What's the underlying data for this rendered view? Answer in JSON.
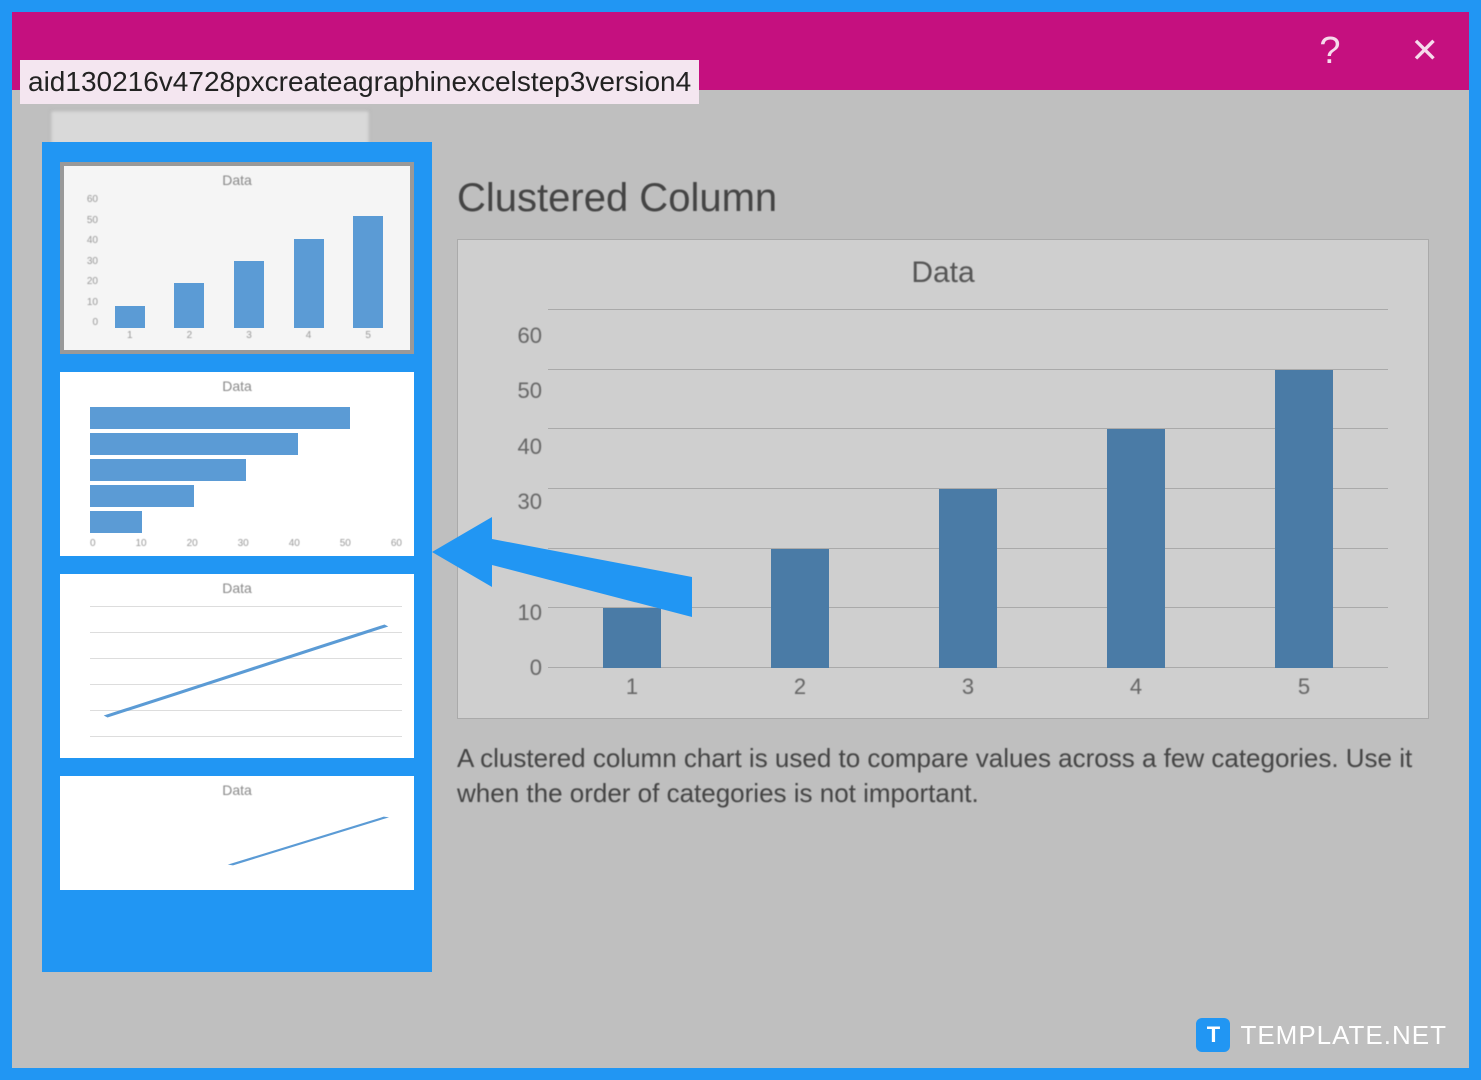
{
  "overlay_label": "aid130216v4728pxcreateagraphinexcelstep3version4",
  "titlebar": {
    "help": "?",
    "close": "✕"
  },
  "sidebar": {
    "thumbs": [
      {
        "title": "Data",
        "type": "column"
      },
      {
        "title": "Data",
        "type": "bar"
      },
      {
        "title": "Data",
        "type": "line"
      },
      {
        "title": "Data",
        "type": "line2"
      }
    ]
  },
  "preview": {
    "heading": "Clustered Column",
    "description": "A clustered column chart is used to compare values across a few categories. Use it when the order of categories is not important."
  },
  "watermark": {
    "badge": "T",
    "text": "TEMPLATE.NET"
  },
  "chart_data": {
    "type": "bar",
    "title": "Data",
    "categories": [
      "1",
      "2",
      "3",
      "4",
      "5"
    ],
    "values": [
      10,
      20,
      30,
      40,
      50
    ],
    "ylabel": "",
    "xlabel": "",
    "ylim": [
      0,
      60
    ],
    "yticks": [
      0,
      10,
      20,
      30,
      40,
      50,
      60
    ]
  },
  "thumb_column_yticks": [
    "0",
    "10",
    "20",
    "30",
    "40",
    "50",
    "60"
  ],
  "thumb_bar_xticks": [
    "0",
    "10",
    "20",
    "30",
    "40",
    "50",
    "60"
  ]
}
